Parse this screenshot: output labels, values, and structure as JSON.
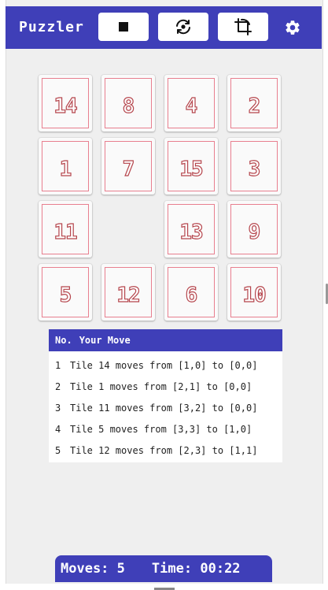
{
  "header": {
    "title": "Puzzler",
    "stop_icon": "stop-icon",
    "restart_icon": "restart-icon",
    "crop_icon": "crop-icon",
    "settings_icon": "gear-icon"
  },
  "board": {
    "rows": [
      [
        "14",
        "8",
        "4",
        "2"
      ],
      [
        "1",
        "7",
        "15",
        "3"
      ],
      [
        "11",
        "",
        "13",
        "9"
      ],
      [
        "5",
        "12",
        "6",
        "10"
      ]
    ]
  },
  "moves_table": {
    "col_no": "No.",
    "col_move": "Your Move",
    "rows": [
      {
        "no": "1",
        "text": "Tile 14 moves from [1,0] to [0,0]"
      },
      {
        "no": "2",
        "text": "Tile 1 moves from [2,1] to [0,0]"
      },
      {
        "no": "3",
        "text": "Tile 11 moves from [3,2] to [0,0]"
      },
      {
        "no": "4",
        "text": "Tile 5 moves from [3,3] to [1,0]"
      },
      {
        "no": "5",
        "text": "Tile 12 moves from [2,3] to [1,1]"
      }
    ]
  },
  "status": {
    "moves_label": "Moves:",
    "moves_value": "5",
    "time_label": "Time:",
    "time_value": "00:22"
  },
  "colors": {
    "primary": "#3f3fb8",
    "tile_border": "#e87f8f",
    "tile_text": "#b5454c"
  }
}
